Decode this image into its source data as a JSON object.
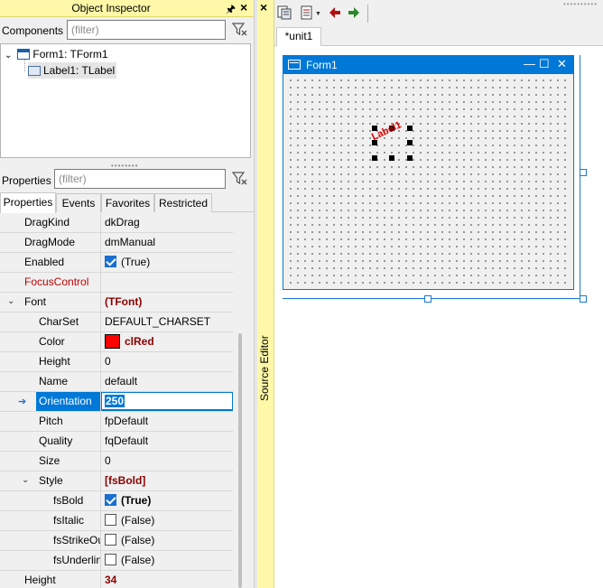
{
  "object_inspector": {
    "title": "Object Inspector",
    "components_label": "Components",
    "components_filter_placeholder": "(filter)",
    "tree": [
      {
        "label": "Form1: TForm1"
      },
      {
        "label": "Label1: TLabel"
      }
    ],
    "properties_label": "Properties",
    "properties_filter_placeholder": "(filter)",
    "tabs": [
      "Properties",
      "Events",
      "Favorites",
      "Restricted"
    ],
    "active_tab": "Properties",
    "rows": [
      {
        "name": "DragKind",
        "value": "dkDrag"
      },
      {
        "name": "DragMode",
        "value": "dmManual"
      },
      {
        "name": "Enabled",
        "value": "(True)",
        "checked": true
      },
      {
        "name": "FocusControl",
        "value": ""
      },
      {
        "name": "Font",
        "value": "(TFont)"
      },
      {
        "name": "CharSet",
        "value": "DEFAULT_CHARSET"
      },
      {
        "name": "Color",
        "value": "clRed"
      },
      {
        "name": "Height",
        "value": "0"
      },
      {
        "name": "Name",
        "value": "default"
      },
      {
        "name": "Orientation",
        "value": "250"
      },
      {
        "name": "Pitch",
        "value": "fpDefault"
      },
      {
        "name": "Quality",
        "value": "fqDefault"
      },
      {
        "name": "Size",
        "value": "0"
      },
      {
        "name": "Style",
        "value": "[fsBold]"
      },
      {
        "name": "fsBold",
        "value": "(True)",
        "checked": true
      },
      {
        "name": "fsItalic",
        "value": "(False)",
        "checked": false
      },
      {
        "name": "fsStrikeOut",
        "value": "(False)",
        "checked": false
      },
      {
        "name": "fsUnderline",
        "value": "(False)",
        "checked": false
      },
      {
        "name": "Height",
        "value": "34"
      }
    ]
  },
  "source_editor": {
    "dock_label": "Source Editor",
    "file_tab": "*unit1",
    "form": {
      "caption": "Form1",
      "label_caption": "Label1",
      "minimize": "—",
      "maximize": "☐",
      "close": "✕"
    }
  },
  "colors": {
    "accent": "#0078d7",
    "dock_title": "#fff8a8",
    "font_color": "#ff0000"
  }
}
